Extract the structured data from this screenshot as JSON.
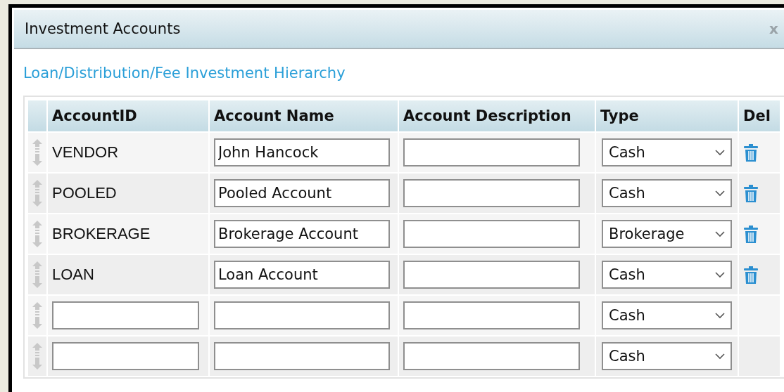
{
  "dialog": {
    "title": "Investment Accounts",
    "close": "x"
  },
  "link": "Loan/Distribution/Fee Investment Hierarchy",
  "table": {
    "columns": [
      "AccountID",
      "Account Name",
      "Account Description",
      "Type",
      "Del"
    ],
    "rows": [
      {
        "kind": "existing",
        "account_id": "VENDOR",
        "account_name": "John Hancock",
        "type": "Cash"
      },
      {
        "kind": "existing",
        "account_id": "POOLED",
        "account_name": "Pooled Account",
        "type": "Cash"
      },
      {
        "kind": "existing",
        "account_id": "BROKERAGE",
        "account_name": "Brokerage Account",
        "type": "Brokerage"
      },
      {
        "kind": "existing",
        "account_id": "LOAN",
        "account_name": "Loan Account",
        "type": "Cash"
      },
      {
        "kind": "new",
        "type": "Cash"
      },
      {
        "kind": "new",
        "type": "Cash"
      }
    ]
  }
}
